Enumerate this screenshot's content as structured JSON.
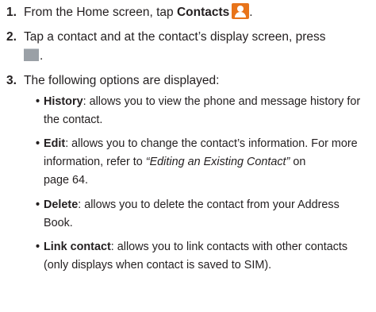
{
  "steps": [
    {
      "number": "1.",
      "text_before": "From the Home screen, tap ",
      "bold": "Contacts",
      "icon": "contacts-app-icon",
      "text_after": "."
    },
    {
      "number": "2.",
      "text_line1": "Tap a contact and at the contact’s display screen, press",
      "icon": "menu-key-icon",
      "text_after": "."
    },
    {
      "number": "3.",
      "text": "The following options are displayed:"
    }
  ],
  "options": [
    {
      "term": "History",
      "line1": ": allows you to view the phone and message history for",
      "line2": "the contact."
    },
    {
      "term": "Edit",
      "line1": ": allows you to change the contact’s information. For more",
      "line2_before": "information, refer to ",
      "link_text": "“Editing an Existing Contact”",
      "line2_after": " on",
      "line3": "page 64."
    },
    {
      "term": "Delete",
      "line1": ": allows you to delete the contact from your Address",
      "line2": "Book."
    },
    {
      "term": "Link contact",
      "line1": ": allows you to link contacts with other contacts",
      "line2": "(only displays when contact is saved to SIM)."
    }
  ],
  "bullet_glyph": "•",
  "colors": {
    "text": "#231f20",
    "contacts_icon": "#e8741a",
    "menu_icon": "#9aa0a6"
  }
}
